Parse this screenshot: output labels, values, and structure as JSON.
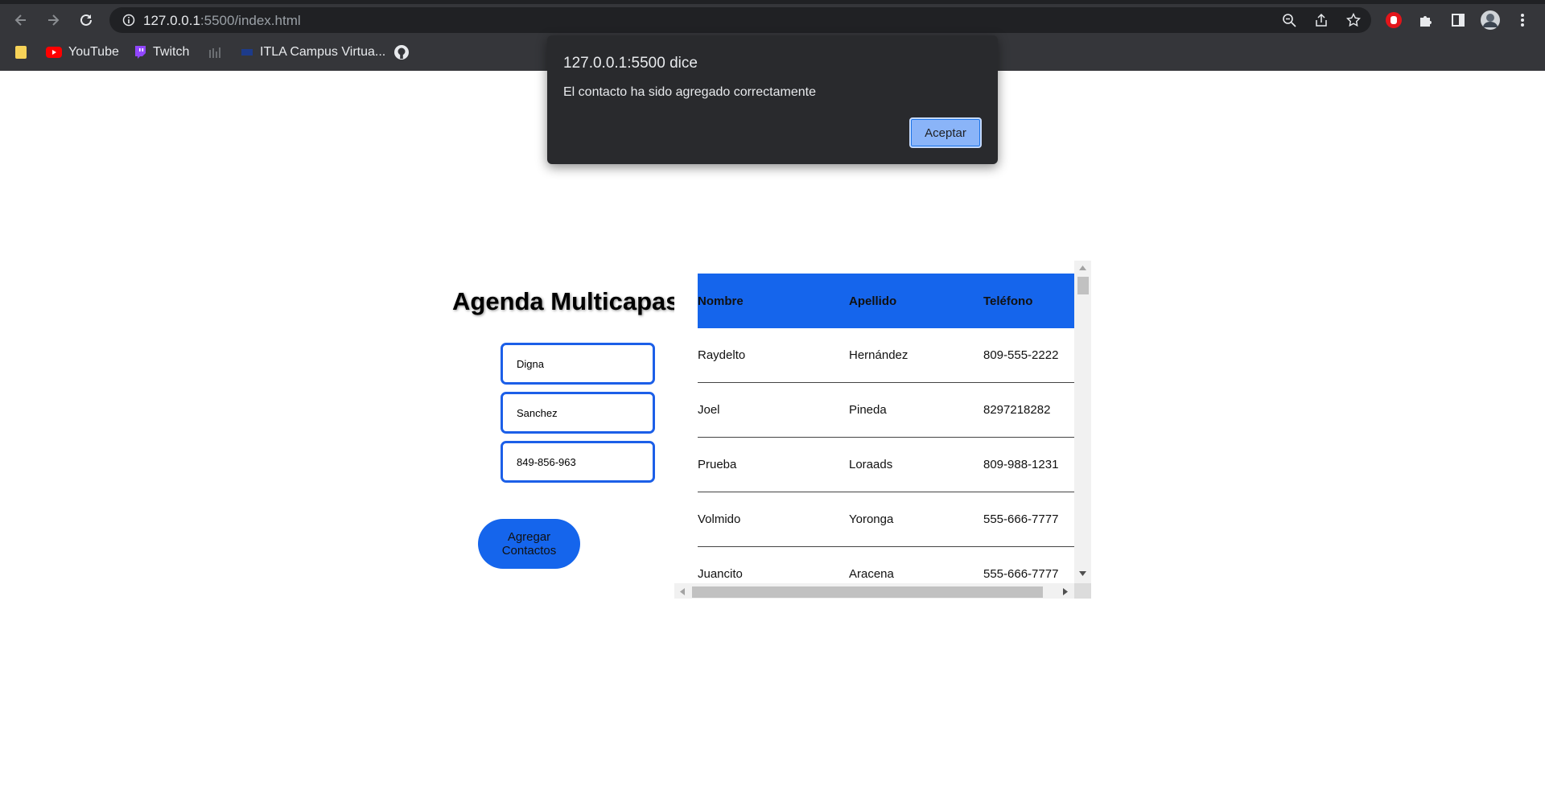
{
  "browser": {
    "url_host": "127.0.0.1",
    "url_rest": ":5500/index.html",
    "bookmarks": [
      {
        "label": ""
      },
      {
        "label": "YouTube"
      },
      {
        "label": "Twitch"
      },
      {
        "label": ""
      },
      {
        "label": "ITLA Campus Virtua..."
      },
      {
        "label": ""
      }
    ]
  },
  "dialog": {
    "title": "127.0.0.1:5500 dice",
    "message": "El contacto ha sido agregado correctamente",
    "ok_label": "Aceptar"
  },
  "app": {
    "title": "Agenda Multicapas",
    "fields": {
      "nombre": "Digna",
      "apellido": "Sanchez",
      "telefono": "849-856-963"
    },
    "add_button": "Agregar Contactos"
  },
  "table": {
    "headers": [
      "Nombre",
      "Apellido",
      "Teléfono"
    ],
    "rows": [
      [
        "Raydelto",
        "Hernández",
        "809-555-2222"
      ],
      [
        "Joel",
        "Pineda",
        "8297218282"
      ],
      [
        "Prueba",
        "Loraads",
        "809-988-1231"
      ],
      [
        "Volmido",
        "Yoronga",
        "555-666-7777"
      ],
      [
        "Juancito",
        "Aracena",
        "555-666-7777"
      ]
    ]
  },
  "colors": {
    "accent": "#1565ec",
    "dialog_bg": "#292a2d",
    "chrome_bg": "#35363a"
  }
}
